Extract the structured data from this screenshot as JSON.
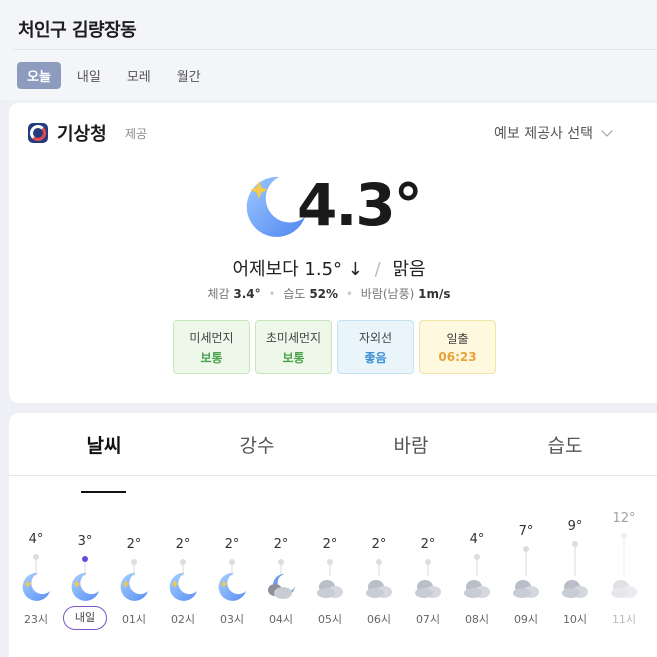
{
  "location": "처인구 김량장동",
  "day_tabs": [
    {
      "label": "오늘",
      "active": true
    },
    {
      "label": "내일",
      "active": false
    },
    {
      "label": "모레",
      "active": false
    },
    {
      "label": "월간",
      "active": false
    }
  ],
  "provider": {
    "name": "기상청",
    "tag": "제공",
    "select_label": "예보 제공사 선택",
    "logo_icon": "kma-logo-icon"
  },
  "current": {
    "icon": "moon-star-icon",
    "temperature": "4.3°",
    "compare_prefix": "어제보다",
    "compare_value": "1.5°",
    "compare_arrow": "↓",
    "condition": "맑음",
    "details": [
      {
        "label": "체감",
        "value": "3.4°"
      },
      {
        "label": "습도",
        "value": "52%"
      },
      {
        "label": "바람(남풍)",
        "value": "1m/s"
      }
    ]
  },
  "badges": [
    {
      "label": "미세먼지",
      "value": "보통",
      "tone": "green"
    },
    {
      "label": "초미세먼지",
      "value": "보통",
      "tone": "green"
    },
    {
      "label": "자외선",
      "value": "좋음",
      "tone": "blue"
    },
    {
      "label": "일출",
      "value": "06:23",
      "tone": "yellow"
    }
  ],
  "category_tabs": [
    {
      "label": "날씨",
      "active": true
    },
    {
      "label": "강수",
      "active": false
    },
    {
      "label": "바람",
      "active": false
    },
    {
      "label": "습도",
      "active": false
    }
  ],
  "hourly": [
    {
      "temp": "4°",
      "temp_value": 4,
      "icon": "moon-star-icon",
      "label": "23시",
      "now": false
    },
    {
      "temp": "3°",
      "temp_value": 3,
      "icon": "moon-star-icon",
      "label": "내일",
      "now": true
    },
    {
      "temp": "2°",
      "temp_value": 2,
      "icon": "moon-star-icon",
      "label": "01시",
      "now": false
    },
    {
      "temp": "2°",
      "temp_value": 2,
      "icon": "moon-star-icon",
      "label": "02시",
      "now": false
    },
    {
      "temp": "2°",
      "temp_value": 2,
      "icon": "moon-star-icon",
      "label": "03시",
      "now": false
    },
    {
      "temp": "2°",
      "temp_value": 2,
      "icon": "moon-cloud-icon",
      "label": "04시",
      "now": false
    },
    {
      "temp": "2°",
      "temp_value": 2,
      "icon": "cloud-icon",
      "label": "05시",
      "now": false
    },
    {
      "temp": "2°",
      "temp_value": 2,
      "icon": "cloud-icon",
      "label": "06시",
      "now": false
    },
    {
      "temp": "2°",
      "temp_value": 2,
      "icon": "cloud-icon",
      "label": "07시",
      "now": false
    },
    {
      "temp": "4°",
      "temp_value": 4,
      "icon": "cloud-icon",
      "label": "08시",
      "now": false
    },
    {
      "temp": "7°",
      "temp_value": 7,
      "icon": "cloud-icon",
      "label": "09시",
      "now": false
    },
    {
      "temp": "9°",
      "temp_value": 9,
      "icon": "cloud-icon",
      "label": "10시",
      "now": false
    },
    {
      "temp": "12°",
      "temp_value": 12,
      "icon": "cloud-icon",
      "label": "11시",
      "now": false
    }
  ]
}
